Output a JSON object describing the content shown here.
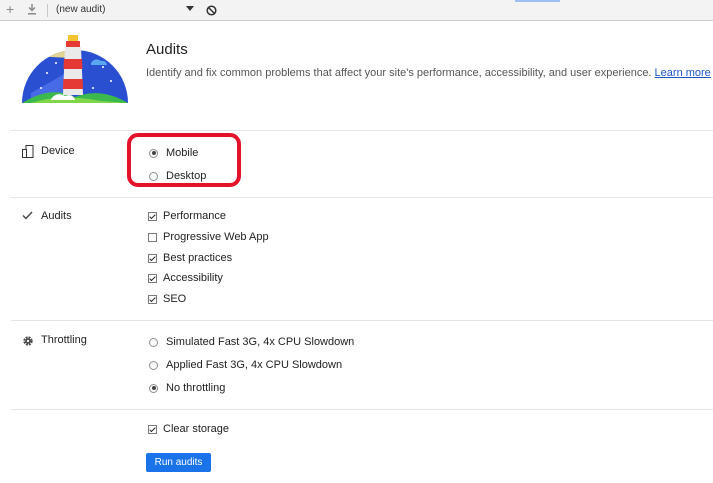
{
  "toolbar": {
    "plus_icon": "plus-icon",
    "download_icon": "download-icon",
    "audit_select": "(new audit)",
    "block_icon": "block-icon"
  },
  "header": {
    "title": "Audits",
    "description": "Identify and fix common problems that affect your site's performance, accessibility, and user experience. ",
    "learn_more": "Learn more"
  },
  "device": {
    "label": "Device",
    "icon": "device-icon",
    "options": [
      {
        "label": "Mobile",
        "selected": true
      },
      {
        "label": "Desktop",
        "selected": false
      }
    ]
  },
  "audits": {
    "label": "Audits",
    "icon": "checkmark-icon",
    "options": [
      {
        "label": "Performance",
        "checked": true
      },
      {
        "label": "Progressive Web App",
        "checked": false
      },
      {
        "label": "Best practices",
        "checked": true
      },
      {
        "label": "Accessibility",
        "checked": true
      },
      {
        "label": "SEO",
        "checked": true
      }
    ]
  },
  "throttling": {
    "label": "Throttling",
    "icon": "gear-icon",
    "options": [
      {
        "label": "Simulated Fast 3G, 4x CPU Slowdown",
        "selected": false
      },
      {
        "label": "Applied Fast 3G, 4x CPU Slowdown",
        "selected": false
      },
      {
        "label": "No throttling",
        "selected": true
      }
    ]
  },
  "clear_storage": {
    "label": "Clear storage",
    "checked": true
  },
  "run_button": "Run audits",
  "colors": {
    "accent": "#1a73e8",
    "highlight": "#e4112a",
    "link": "#1a55c9"
  }
}
